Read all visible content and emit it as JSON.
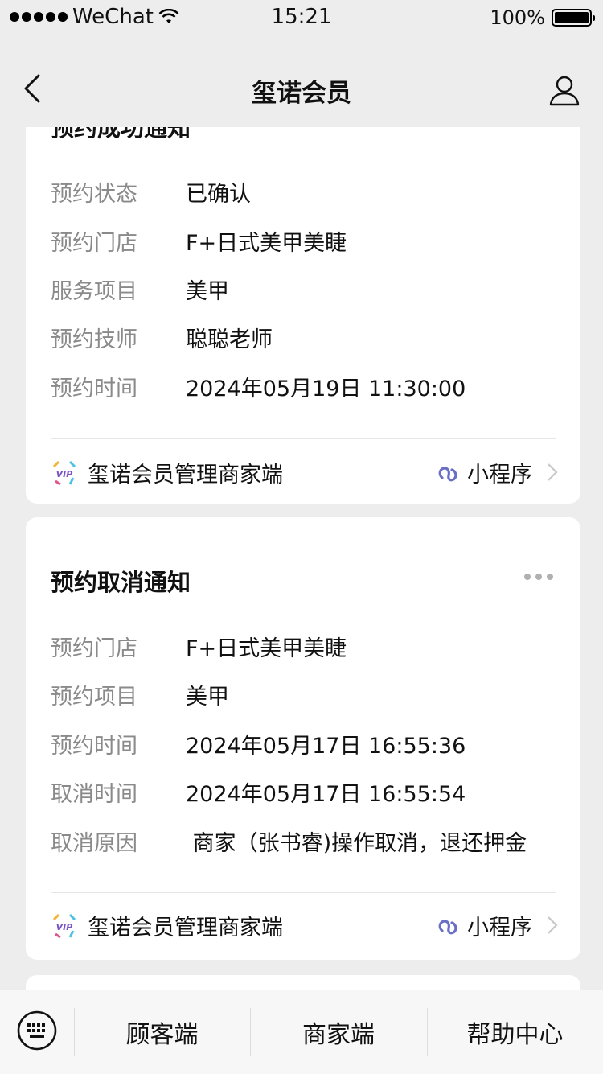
{
  "status_bar": {
    "carrier": "WeChat",
    "time": "15:21",
    "battery": "100%"
  },
  "nav": {
    "title": "玺诺会员"
  },
  "top_card": {
    "title_partial": "预约成功通知",
    "rows": [
      {
        "label": "预约状态",
        "value": "已确认"
      },
      {
        "label": "预约门店",
        "value": "F+日式美甲美睫"
      },
      {
        "label": "服务项目",
        "value": "美甲"
      },
      {
        "label": "预约技师",
        "value": "聪聪老师"
      },
      {
        "label": "预约时间",
        "value": "2024年05月19日 11:30:00"
      }
    ],
    "footer": {
      "app_name": "玺诺会员管理商家端",
      "mini_program": "小程序"
    }
  },
  "cancel_card": {
    "title": "预约取消通知",
    "rows": [
      {
        "label": "预约门店",
        "value": "F+日式美甲美睫"
      },
      {
        "label": "预约项目",
        "value": "美甲"
      },
      {
        "label": "预约时间",
        "value": "2024年05月17日 16:55:36"
      },
      {
        "label": "取消时间",
        "value": "2024年05月17日 16:55:54"
      },
      {
        "label": "取消原因",
        "value": " 商家（张书睿)操作取消，退还押金"
      }
    ],
    "footer": {
      "app_name": "玺诺会员管理商家端",
      "mini_program": "小程序"
    }
  },
  "bottom_menu": {
    "items": [
      "顾客端",
      "商家端",
      "帮助中心"
    ]
  },
  "colors": {
    "background": "#ededed",
    "card": "#ffffff",
    "label": "#8a8a8a",
    "mini_program_icon": "#6a6fc6"
  }
}
